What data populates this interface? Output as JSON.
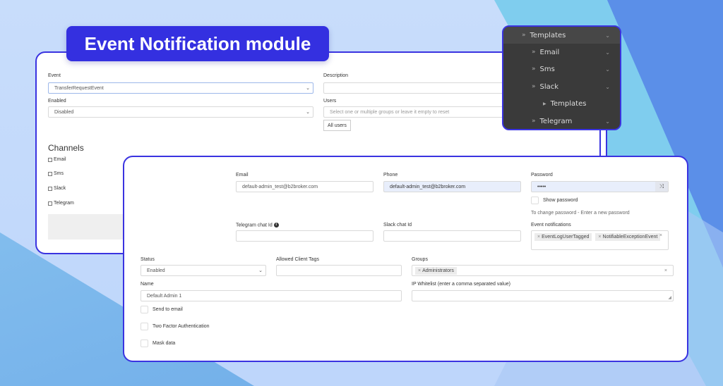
{
  "title": "Event Notification module",
  "colors": {
    "accent": "#3430e0",
    "menu_bg": "#3a3a3a",
    "filled_input_bg": "#e8eefb"
  },
  "event_form": {
    "event": {
      "label": "Event",
      "value": "TransferRequestEvent"
    },
    "enabled": {
      "label": "Enabled",
      "value": "Disabled"
    },
    "description": {
      "label": "Description",
      "value": ""
    },
    "users": {
      "label": "Users",
      "placeholder": "Select one or multiple groups or leave it empty to reset",
      "all_users_button": "All users"
    },
    "channels": {
      "title": "Channels",
      "items": [
        {
          "label": "Email",
          "checked": false
        },
        {
          "label": "Sms",
          "checked": false
        },
        {
          "label": "Slack",
          "checked": false
        },
        {
          "label": "Telegram",
          "checked": false
        }
      ]
    }
  },
  "menu": {
    "items": [
      {
        "label": "Templates",
        "icon": "double-chevron-right-icon",
        "level": 0,
        "expandable": true,
        "active": true
      },
      {
        "label": "Email",
        "icon": "double-chevron-right-icon",
        "level": 1,
        "expandable": true
      },
      {
        "label": "Sms",
        "icon": "double-chevron-right-icon",
        "level": 1,
        "expandable": true
      },
      {
        "label": "Slack",
        "icon": "double-chevron-right-icon",
        "level": 1,
        "expandable": true
      },
      {
        "label": "Templates",
        "icon": "triangle-right-icon",
        "level": 2,
        "expandable": false
      },
      {
        "label": "Telegram",
        "icon": "double-chevron-right-icon",
        "level": 1,
        "expandable": true
      }
    ]
  },
  "user_form": {
    "email": {
      "label": "Email",
      "value": "default-admin_test@b2broker.com"
    },
    "phone": {
      "label": "Phone",
      "value": "default-admin_test@b2broker.com"
    },
    "password": {
      "label": "Password",
      "value": "•••••",
      "show_password_label": "Show password",
      "hint": "To change password - Enter a new password"
    },
    "telegram_chat_id": {
      "label": "Telegram chat Id",
      "value": ""
    },
    "slack_chat_id": {
      "label": "Slack chat Id",
      "value": ""
    },
    "event_notifications": {
      "label": "Event notifications",
      "tags": [
        "EventLogUserTagged",
        "NotifiableExceptionEvent"
      ]
    },
    "status": {
      "label": "Status",
      "value": "Enabled"
    },
    "allowed_client_tags": {
      "label": "Allowed Client Tags",
      "value": ""
    },
    "groups": {
      "label": "Groups",
      "tags": [
        "Administrators"
      ]
    },
    "name": {
      "label": "Name",
      "value": "Default Admin 1"
    },
    "ip_whitelist": {
      "label": "IP Whitelist (enter a comma separated value)",
      "value": ""
    },
    "checkboxes": [
      {
        "label": "Send to email",
        "checked": false
      },
      {
        "label": "Two Factor Authentication",
        "checked": false
      },
      {
        "label": "Mask data",
        "checked": false
      }
    ]
  }
}
